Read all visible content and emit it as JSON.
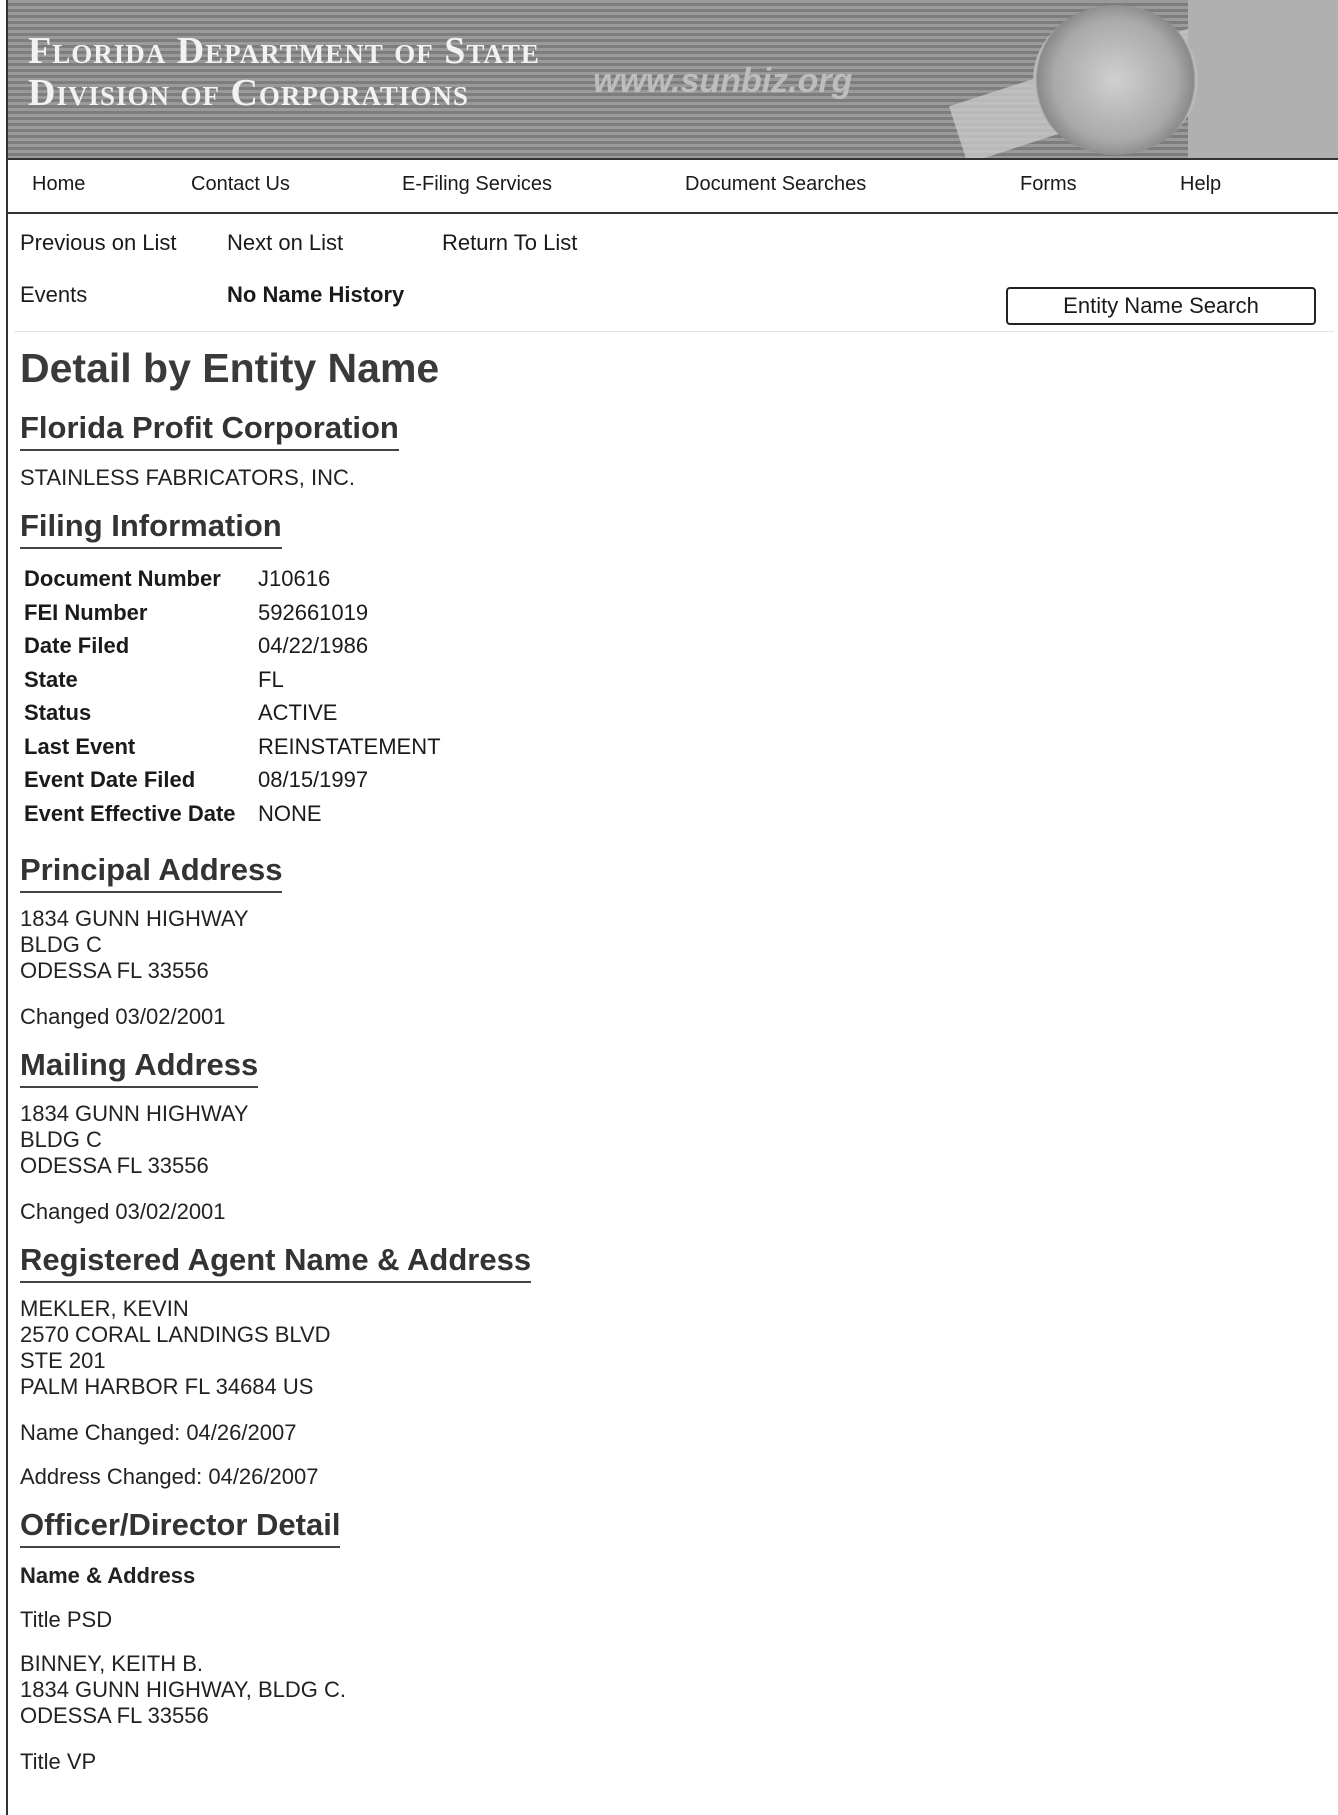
{
  "banner": {
    "line1": "Florida Department of State",
    "line2": "Division of Corporations",
    "url": "www.sunbiz.org"
  },
  "nav": {
    "home": "Home",
    "contact": "Contact Us",
    "efiling": "E-Filing Services",
    "docsearch": "Document Searches",
    "forms": "Forms",
    "help": "Help"
  },
  "listnav": {
    "previous": "Previous on List",
    "next": "Next on List",
    "return": "Return To List",
    "events": "Events",
    "name_history": "No Name History",
    "search_button": "Entity Name Search"
  },
  "detail": {
    "title": "Detail by Entity Name",
    "corp_type": "Florida Profit Corporation",
    "entity_name": "STAINLESS FABRICATORS, INC."
  },
  "filing": {
    "heading": "Filing Information",
    "rows": [
      {
        "label": "Document Number",
        "value": "J10616"
      },
      {
        "label": "FEI Number",
        "value": "592661019"
      },
      {
        "label": "Date Filed",
        "value": "04/22/1986"
      },
      {
        "label": "State",
        "value": "FL"
      },
      {
        "label": "Status",
        "value": "ACTIVE"
      },
      {
        "label": "Last Event",
        "value": "REINSTATEMENT"
      },
      {
        "label": "Event Date Filed",
        "value": "08/15/1997"
      },
      {
        "label": "Event Effective Date",
        "value": "NONE"
      }
    ]
  },
  "principal": {
    "heading": "Principal Address",
    "address": "1834 GUNN HIGHWAY\nBLDG C\nODESSA FL 33556",
    "changed": "Changed 03/02/2001"
  },
  "mailing": {
    "heading": "Mailing Address",
    "address": "1834 GUNN HIGHWAY\nBLDG C\nODESSA FL 33556",
    "changed": "Changed 03/02/2001"
  },
  "agent": {
    "heading": "Registered Agent Name & Address",
    "address": "MEKLER, KEVIN\n2570 CORAL LANDINGS BLVD\nSTE 201\nPALM HARBOR FL 34684 US",
    "name_changed": "Name Changed: 04/26/2007",
    "address_changed": "Address Changed: 04/26/2007"
  },
  "officers": {
    "heading": "Officer/Director Detail",
    "subheading": "Name & Address",
    "title1": "Title PSD",
    "officer1": "BINNEY, KEITH B.\n1834 GUNN HIGHWAY, BLDG C.\nODESSA FL 33556",
    "title2": "Title VP"
  }
}
